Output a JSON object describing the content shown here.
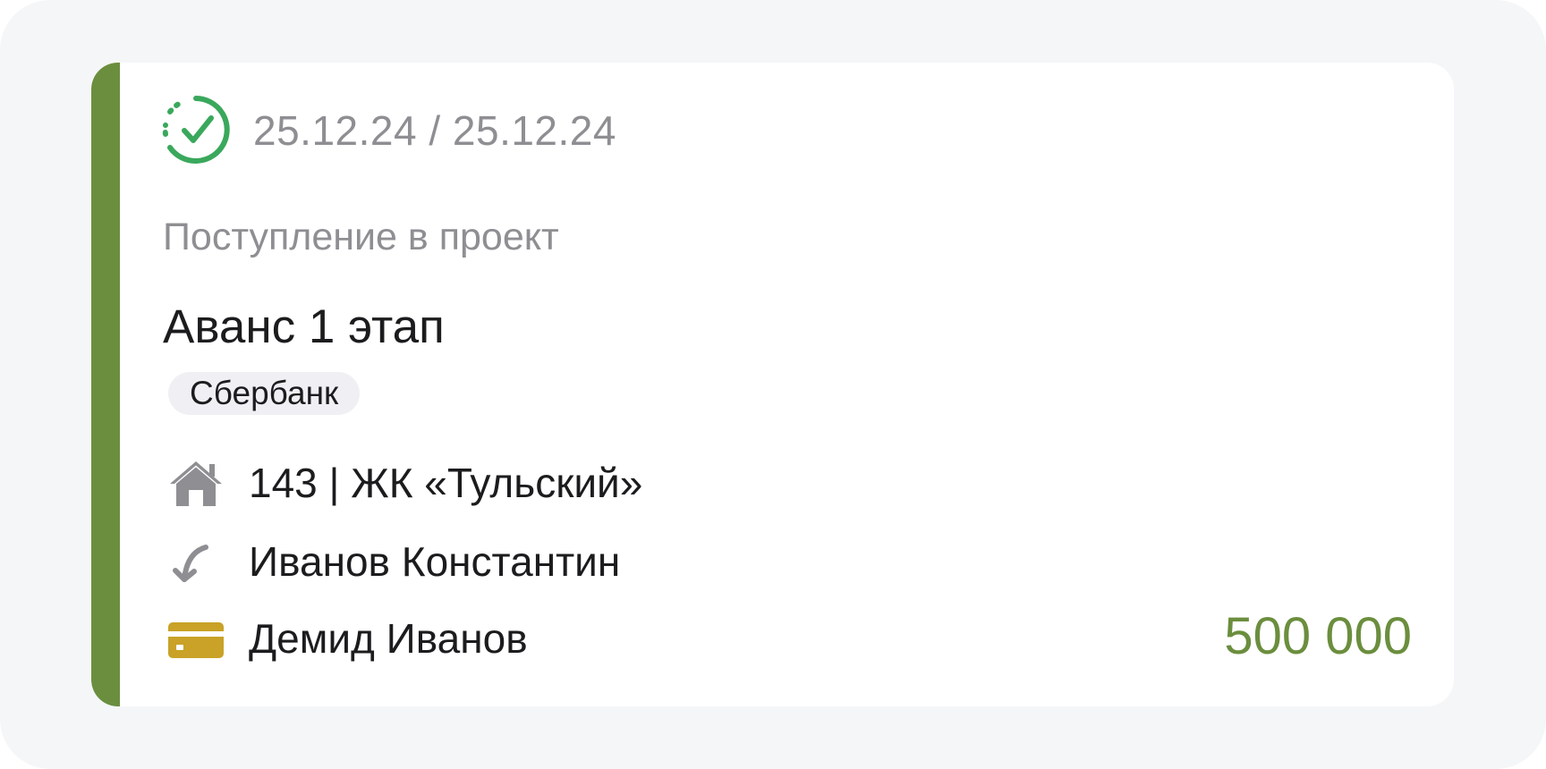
{
  "colors": {
    "accent_bar": "#6b8e3e",
    "status_icon": "#3aa85c",
    "amount": "#6b8e3e",
    "card_icon": "#c9a227",
    "muted_icon": "#8e8e93"
  },
  "card": {
    "status_icon": "check-circle-icon",
    "dates": "25.12.24 / 25.12.24",
    "category": "Поступление в проект",
    "title": "Аванс 1 этап",
    "tag": "Сбербанк",
    "rows": [
      {
        "icon": "house-icon",
        "text": "143 | ЖК «Тульский»"
      },
      {
        "icon": "incoming-arrow-icon",
        "text": "Иванов Константин"
      },
      {
        "icon": "bank-card-icon",
        "text": "Демид Иванов"
      }
    ],
    "amount": "500 000"
  }
}
